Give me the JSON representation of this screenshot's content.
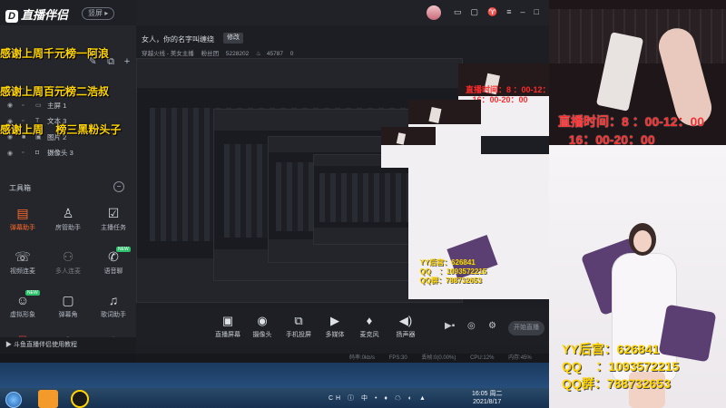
{
  "app": {
    "logo": "直播伴侣",
    "mode_button": "竖屏"
  },
  "ticker": {
    "lines": [
      "感谢上周千元榜一阿浪",
      "感谢上周百元榜二浩叔",
      "感谢上周    榜三黑粉头子"
    ]
  },
  "sources": [
    {
      "label": "文本 4",
      "icon": "text-icon"
    },
    {
      "label": "主屏 1",
      "icon": "monitor-icon"
    },
    {
      "label": "文本 3",
      "icon": "text-icon"
    },
    {
      "label": "图片 2",
      "icon": "image-icon"
    },
    {
      "label": "摄像头 3",
      "icon": "camera-icon"
    }
  ],
  "toolbox": {
    "title": "工具箱",
    "tools": [
      {
        "label": "弹幕助手",
        "icon": "danmaku-icon",
        "active": true
      },
      {
        "label": "房管助手",
        "icon": "admin-icon"
      },
      {
        "label": "主播任务",
        "icon": "task-icon"
      },
      {
        "label": "视频连麦",
        "icon": "video-link-icon"
      },
      {
        "label": "多人连麦",
        "icon": "multi-link-icon"
      },
      {
        "label": "语音聊",
        "icon": "voice-chat-icon",
        "badge": "NEW"
      },
      {
        "label": "虚拟形象",
        "icon": "avatar-icon",
        "badge": "NEW"
      },
      {
        "label": "弹幕角",
        "icon": "tv-icon"
      },
      {
        "label": "歌词助手",
        "icon": "lyrics-icon"
      }
    ],
    "footer": "斗鱼直播伴侣使用教程"
  },
  "room": {
    "title": "女人，你的名字叫缠绕",
    "edit": "修改",
    "meta": [
      "穿越火线 - 美女主播",
      "粉丝团",
      "5228202",
      "45787",
      "0"
    ]
  },
  "dock": {
    "buttons": [
      {
        "label": "直播屏幕",
        "icon": "screen-icon"
      },
      {
        "label": "摄像头",
        "icon": "camera-icon"
      },
      {
        "label": "手机投屏",
        "icon": "phone-cast-icon"
      },
      {
        "label": "多媒体",
        "icon": "media-icon"
      },
      {
        "label": "麦克风",
        "icon": "mic-icon"
      },
      {
        "label": "扬声器",
        "icon": "speaker-icon"
      }
    ],
    "go_live": "开始直播"
  },
  "status": {
    "items": [
      "码率:0kb/s",
      "FPS:30",
      "丢帧:0(0.00%)",
      "CPU:12%",
      "内存:45%"
    ]
  },
  "camera": {
    "broadcast_time": "直播时间：8 ：00-12：00\n   16：00-20：00",
    "contact": "YY后宫：626841\nQQ    ：1093572215\nQQ群：788732653"
  },
  "taskbar": {
    "time": "16:05 周二",
    "date": "2021/8/17",
    "tray": "CH ⓘ 中 • ♦ ☁ ◐ ▲"
  },
  "colors": {
    "accent": "#ff6a2a",
    "ticker": "#ffd400",
    "broadcast_time": "#ff2a2a"
  }
}
